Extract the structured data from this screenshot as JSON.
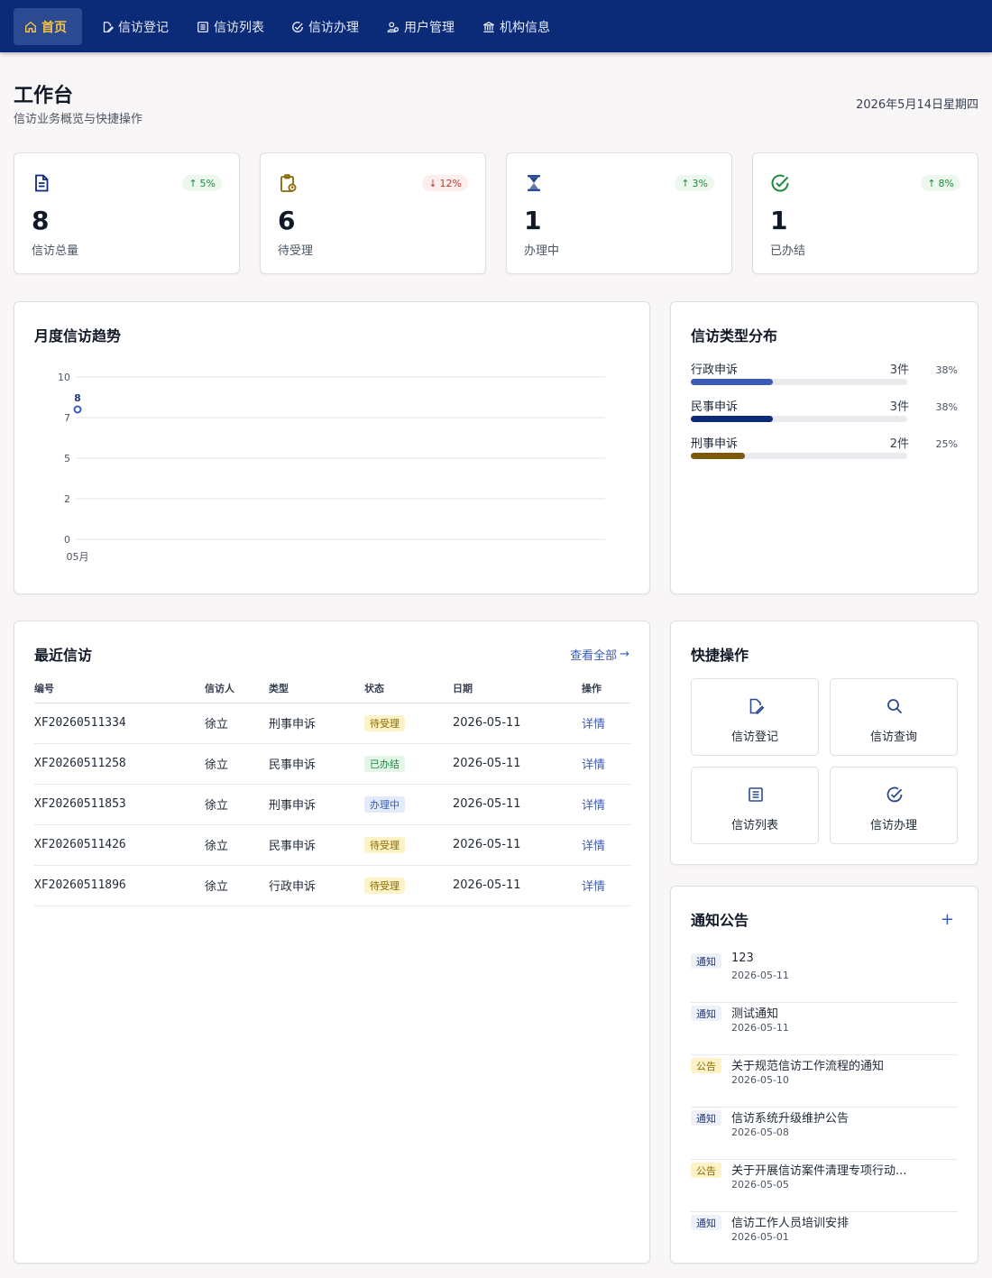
{
  "nav": [
    {
      "label": "首页",
      "icon": "home-icon"
    },
    {
      "label": "信访登记",
      "icon": "file-edit-icon"
    },
    {
      "label": "信访列表",
      "icon": "list-icon"
    },
    {
      "label": "信访办理",
      "icon": "check-circle-icon"
    },
    {
      "label": "用户管理",
      "icon": "users-icon"
    },
    {
      "label": "机构信息",
      "icon": "bank-icon"
    }
  ],
  "header": {
    "title": "工作台",
    "subtitle": "信访业务概览与快捷操作",
    "date": "2026年5月14日星期四"
  },
  "stats": [
    {
      "value": "8",
      "label": "信访总量",
      "trend": "5%",
      "direction": "up",
      "icon": "document-icon",
      "color": "#0b2a78"
    },
    {
      "value": "6",
      "label": "待受理",
      "trend": "12%",
      "direction": "down",
      "icon": "clipboard-clock-icon",
      "color": "#8a6a06"
    },
    {
      "value": "1",
      "label": "办理中",
      "trend": "3%",
      "direction": "up",
      "icon": "hourglass-icon",
      "color": "#2c4a91"
    },
    {
      "value": "1",
      "label": "已办结",
      "trend": "8%",
      "direction": "up",
      "icon": "check-circle-icon",
      "color": "#1f8a3b"
    }
  ],
  "trend_chart": {
    "title": "月度信访趋势",
    "chart_data": {
      "type": "line",
      "x": [
        "05月"
      ],
      "series": [
        {
          "values": [
            8
          ]
        }
      ],
      "yticks": [
        "10",
        "7",
        "5",
        "2",
        "0"
      ],
      "ylim": [
        0,
        10
      ],
      "data_labels": [
        "8"
      ],
      "grid": true,
      "color": "#3b5bb7"
    }
  },
  "distribution": {
    "title": "信访类型分布",
    "items": [
      {
        "name": "行政申诉",
        "count": "3件",
        "pct": "38%",
        "value": 0.38,
        "color": "#3b5bb7"
      },
      {
        "name": "民事申诉",
        "count": "3件",
        "pct": "38%",
        "value": 0.38,
        "color": "#0b2a78"
      },
      {
        "name": "刑事申诉",
        "count": "2件",
        "pct": "25%",
        "value": 0.25,
        "color": "#7a5a0a"
      }
    ]
  },
  "recent": {
    "title": "最近信访",
    "view_all": "查看全部",
    "columns": [
      "编号",
      "信访人",
      "类型",
      "状态",
      "日期",
      "操作"
    ],
    "rows": [
      {
        "code": "XF20260511334",
        "person": "徐立",
        "type": "刑事申诉",
        "status": "待受理",
        "status_kind": "pending",
        "date": "2026-05-11",
        "action": "详情"
      },
      {
        "code": "XF20260511258",
        "person": "徐立",
        "type": "民事申诉",
        "status": "已办结",
        "status_kind": "done",
        "date": "2026-05-11",
        "action": "详情"
      },
      {
        "code": "XF20260511853",
        "person": "徐立",
        "type": "刑事申诉",
        "status": "办理中",
        "status_kind": "doing",
        "date": "2026-05-11",
        "action": "详情"
      },
      {
        "code": "XF20260511426",
        "person": "徐立",
        "type": "民事申诉",
        "status": "待受理",
        "status_kind": "pending",
        "date": "2026-05-11",
        "action": "详情"
      },
      {
        "code": "XF20260511896",
        "person": "徐立",
        "type": "行政申诉",
        "status": "待受理",
        "status_kind": "pending",
        "date": "2026-05-11",
        "action": "详情"
      }
    ]
  },
  "quick": {
    "title": "快捷操作",
    "items": [
      {
        "label": "信访登记",
        "icon": "file-edit-icon"
      },
      {
        "label": "信访查询",
        "icon": "search-icon"
      },
      {
        "label": "信访列表",
        "icon": "list-icon"
      },
      {
        "label": "信访办理",
        "icon": "check-circle-icon"
      }
    ]
  },
  "notices": {
    "title": "通知公告",
    "add": "+",
    "items": [
      {
        "tag": "通知",
        "kind": "tongzhi",
        "title": "123",
        "date": "2026-05-11"
      },
      {
        "tag": "通知",
        "kind": "tongzhi",
        "title": "测试通知",
        "date": "2026-05-11"
      },
      {
        "tag": "公告",
        "kind": "gonggao",
        "title": "关于规范信访工作流程的通知",
        "date": "2026-05-10"
      },
      {
        "tag": "通知",
        "kind": "tongzhi",
        "title": "信访系统升级维护公告",
        "date": "2026-05-08"
      },
      {
        "tag": "公告",
        "kind": "gonggao",
        "title": "关于开展信访案件清理专项行动...",
        "date": "2026-05-05"
      },
      {
        "tag": "通知",
        "kind": "tongzhi",
        "title": "信访工作人员培训安排",
        "date": "2026-05-01"
      }
    ]
  }
}
